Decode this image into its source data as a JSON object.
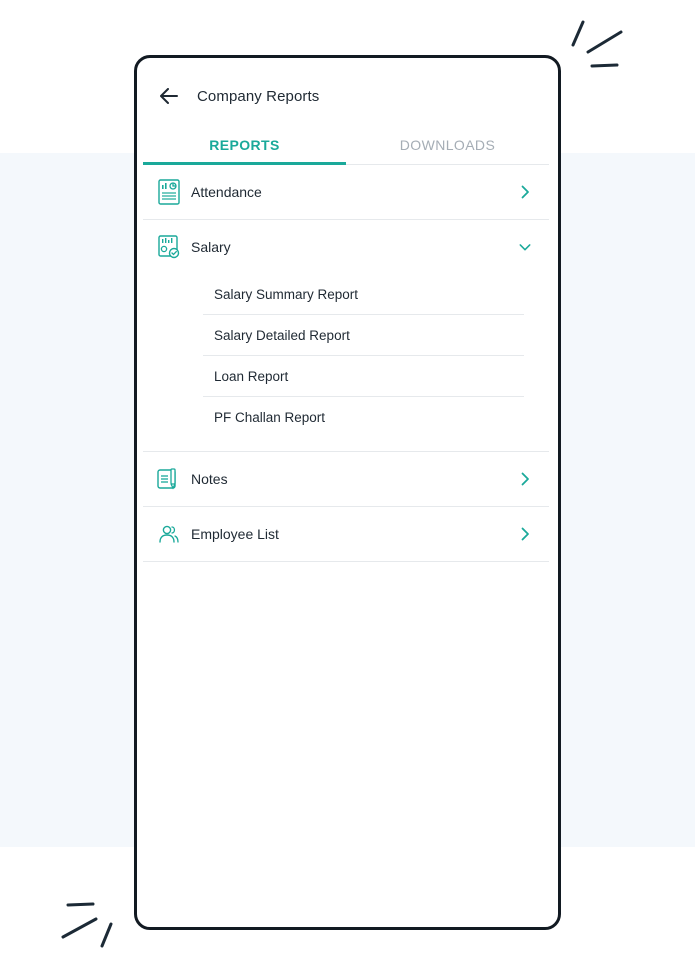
{
  "header": {
    "title": "Company Reports"
  },
  "tabs": [
    {
      "label": "REPORTS",
      "active": true
    },
    {
      "label": "DOWNLOADS",
      "active": false
    }
  ],
  "reports": {
    "attendance": {
      "label": "Attendance",
      "icon": "report-icon"
    },
    "salary": {
      "label": "Salary",
      "icon": "salary-icon",
      "expanded": true,
      "items": [
        "Salary Summary Report",
        "Salary Detailed Report",
        "Loan Report",
        "PF Challan Report"
      ]
    },
    "notes": {
      "label": "Notes",
      "icon": "notes-icon"
    },
    "employee_list": {
      "label": "Employee List",
      "icon": "users-icon"
    }
  },
  "colors": {
    "accent": "#1aa99a",
    "text": "#1f2933",
    "inactive_tab": "#a5adb5",
    "divider": "#e6e9ec",
    "background_band": "#f4f8fc"
  }
}
